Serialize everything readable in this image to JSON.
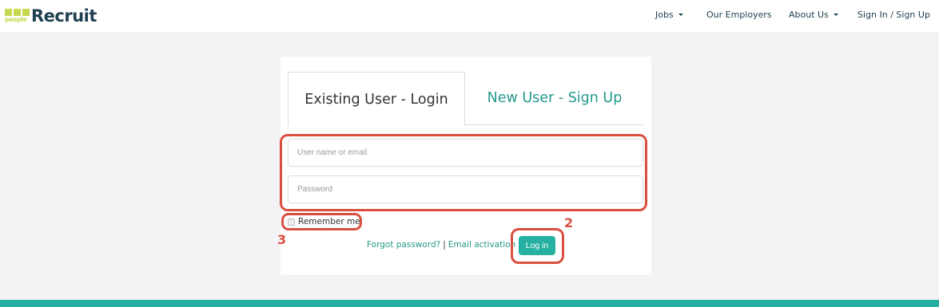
{
  "brand": {
    "logo_word": "people",
    "name": "Recruit",
    "accent_color": "#c6d84f",
    "text_color": "#1f4050"
  },
  "nav": {
    "items": [
      {
        "label": "Jobs",
        "has_dropdown": true
      },
      {
        "label": "Our Employers",
        "has_dropdown": false
      },
      {
        "label": "About Us",
        "has_dropdown": true
      },
      {
        "label": "Sign In / Sign Up",
        "has_dropdown": false
      }
    ]
  },
  "login": {
    "tabs": [
      {
        "label": "Existing User - Login",
        "active": true
      },
      {
        "label": "New User - Sign Up",
        "active": false
      }
    ],
    "username_placeholder": "User name or email",
    "username_value": "",
    "password_placeholder": "Password",
    "password_value": "",
    "remember_label": "Remember me",
    "remember_checked": false,
    "forgot_link": "Forgot password?",
    "separator": "|",
    "activation_link": "Email activation",
    "login_button": "Log in"
  },
  "annotations": [
    {
      "number": "2",
      "target": "login-button"
    },
    {
      "number": "3",
      "target": "remember-me"
    }
  ],
  "colors": {
    "primary": "#25b0a2",
    "link": "#24998c",
    "annotation": "#d9503f",
    "page_bg": "#f3f3f5"
  }
}
